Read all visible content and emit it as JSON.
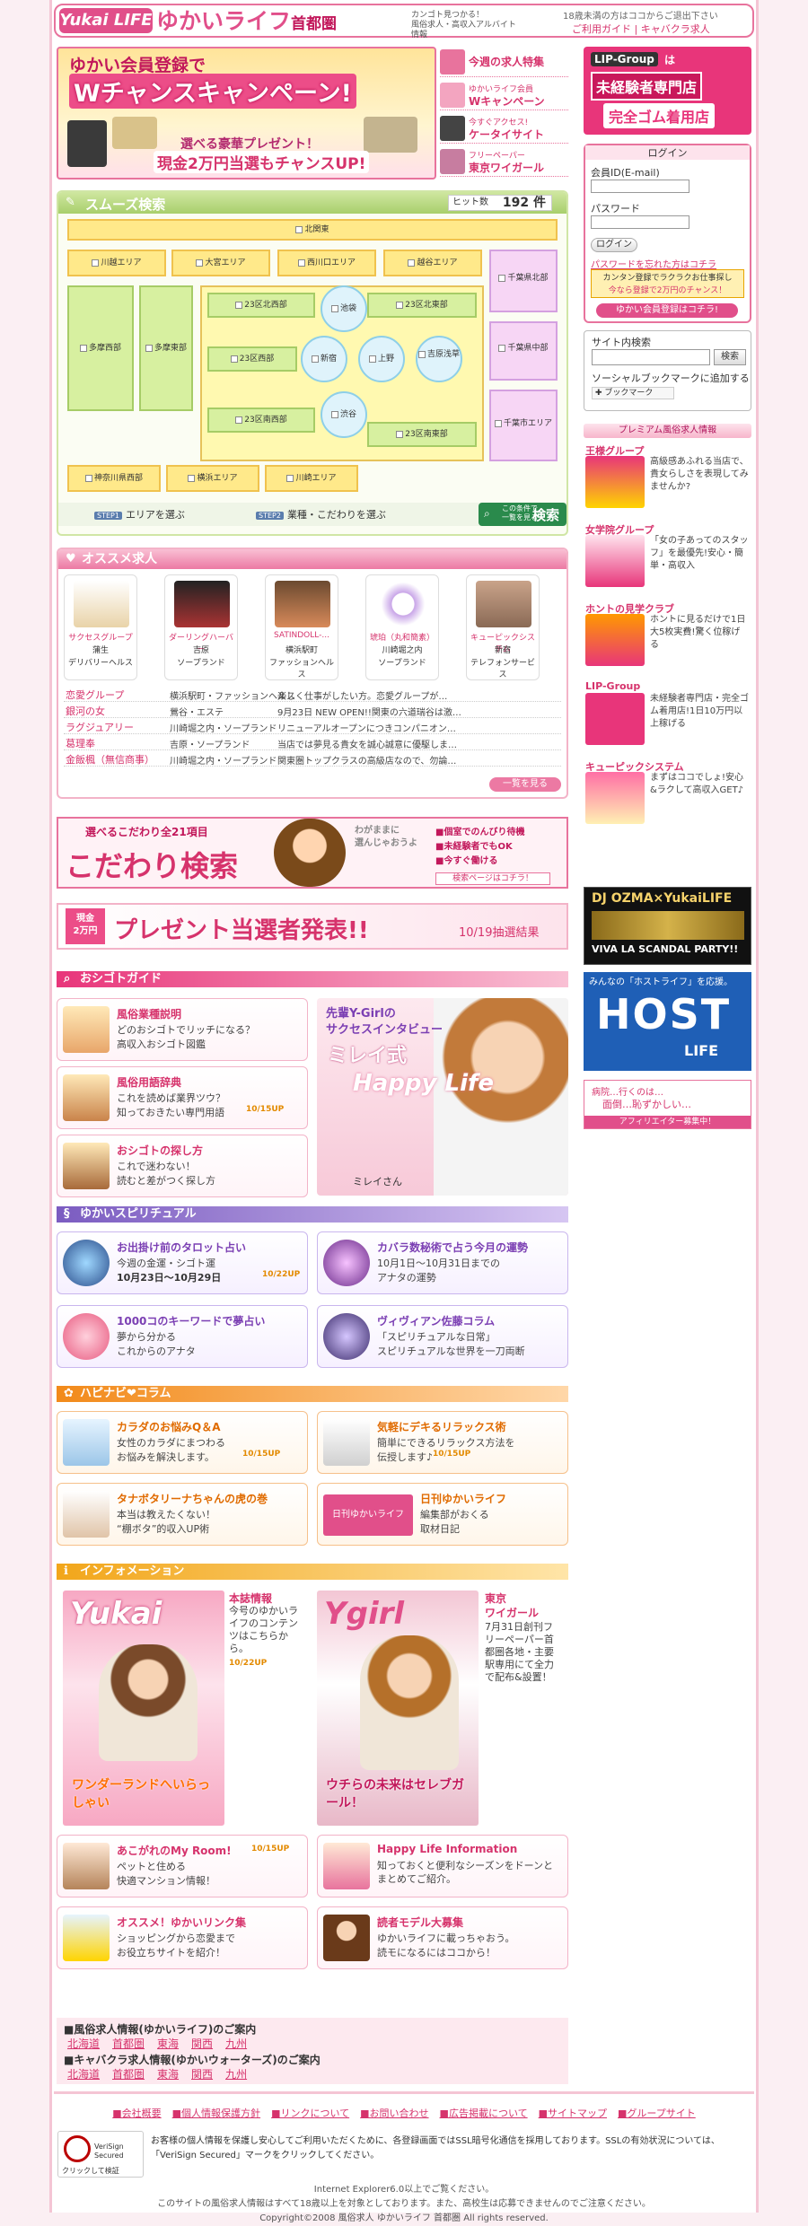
{
  "header": {
    "logo": "Yukai LIFE",
    "brand": "ゆかいライフ",
    "brand_city": "首都圏",
    "tagline1": "カンゴト見つかる！",
    "tagline2": "風俗求人・高収入アルバイト情報",
    "age_note": "18歳未満の方はココからご退出下さい",
    "usage_guide": "ご利用ガイド",
    "cabaret": "キャバクラ求人"
  },
  "campaign": {
    "line1": "ゆかい会員登録で",
    "line2": "Wチャンスキャンペーン!",
    "line3": "選べる豪華プレゼント！",
    "line4": "現金2万円当選もチャンスUP!"
  },
  "topics": [
    {
      "t1": "",
      "t2": "今週の求人特集"
    },
    {
      "t1": "ゆかいライフ会員",
      "t2": "Wキャンペーン"
    },
    {
      "t1": "今すぐアクセス!",
      "t2": "ケータイサイト"
    },
    {
      "t1": "フリーペーパー",
      "t2": "東京ワイガール"
    }
  ],
  "lip": {
    "logo": "LIP-Group",
    "wa": "は",
    "line1": "未経験者専門店",
    "line2": "完全ゴム着用店"
  },
  "login": {
    "title": "ログイン",
    "id_label": "会員ID(E-mail)",
    "pw_label": "パスワード",
    "button": "ログイン",
    "forgot": "パスワードを忘れた方はコチラ",
    "promo1": "カンタン登録でラクラクお仕事探し",
    "promo2": "今なら登録で2万円のチャンス！",
    "register": "ゆかい会員登録はコチラ!"
  },
  "search": {
    "label": "サイト内検索",
    "button": "検索",
    "social": "ソーシャルブックマークに追加する",
    "bookmark": "ブックマーク"
  },
  "premium": {
    "title": "プレミアム風俗求人情報",
    "items": [
      {
        "name": "王様グループ",
        "desc": "高級感あふれる当店で、貴女らしさを表現してみませんか?"
      },
      {
        "name": "女学院グループ",
        "desc": "「女の子あってのスタッフ」を最優先!安心・簡単・高収入"
      },
      {
        "name": "ホントの見学クラブ",
        "desc": "ホントに見るだけで1日大5枚実費!驚く位稼げる"
      },
      {
        "name": "LIP-Group",
        "desc": "未経験者専門店・完全ゴム着用店!1日10万円以上稼げる"
      },
      {
        "name": "キューピックシステム",
        "desc": "まずはココでしょ!安心&ラクして高収入GET♪"
      }
    ]
  },
  "dj": {
    "t1": "DJ OZMA×YukaiLIFE",
    "t2": "VIVA LA SCANDAL PARTY!!"
  },
  "host": {
    "t1": "みんなの「ホストライフ」を応援。",
    "t2": "HOST",
    "t3": "LIFE"
  },
  "affiliate": {
    "t1": "病院…行くのは…",
    "t2": "面倒…恥ずかしい…",
    "t3": "アフィリエイター募集中！"
  },
  "smooth": {
    "title": "スムーズ検索",
    "hit_label": "ヒット数",
    "hit_count": "192",
    "hit_unit": "件",
    "areas": {
      "kitakanto": "北関東",
      "kawagoe": "川越エリア",
      "omiya": "大宮エリア",
      "nishiguchi": "西川口エリア",
      "koshigaya": "越谷エリア",
      "chiba_n": "千葉県北部",
      "tama_w": "多摩西部",
      "tama_e": "多摩東部",
      "ku_nw": "23区北西部",
      "ikebukuro": "池袋",
      "ku_ne": "23区北東部",
      "ku_w": "23区西部",
      "shinjuku": "新宿",
      "ueno": "上野",
      "kinshi": "吉原浅草",
      "chiba_c": "千葉県中部",
      "ku_sw": "23区南西部",
      "shibuya": "渋谷",
      "ku_se": "23区南東部",
      "chiba_s": "千葉市エリア",
      "kanagawa": "神奈川県西部",
      "yokohama": "横浜エリア",
      "kawasaki": "川崎エリア"
    },
    "step1_tag": "STEP1",
    "step1": "エリアを選ぶ",
    "step2_tag": "STEP2",
    "step2": "業種・こだわりを選ぶ",
    "go_small1": "この条件で",
    "go_small2": "一覧を見る",
    "go": "検索"
  },
  "recommend": {
    "title": "オススメ求人",
    "cards": [
      {
        "name": "サクセスグループ",
        "loc": "蒲生",
        "type": "デリバリーヘルス"
      },
      {
        "name": "ダーリングハーバー",
        "loc": "吉原",
        "type": "ソープランド"
      },
      {
        "name": "SATINDOLL-...",
        "loc": "横浜駅町",
        "type": "ファッションヘルス"
      },
      {
        "name": "琥珀（丸和簡素）",
        "loc": "川崎堀之内",
        "type": "ソープランド"
      },
      {
        "name": "キューピックシステム",
        "loc": "新宿",
        "type": "テレフォンサービス"
      }
    ],
    "rows": [
      {
        "c1": "恋愛グループ",
        "c2": "横浜駅町・ファッションヘルス",
        "c3": "楽しく仕事がしたい方。恋愛グループが…"
      },
      {
        "c1": "銀河の女",
        "c2": "鶯谷・エステ",
        "c3": "9月23日 NEW OPEN!!関東の六道瑞谷は激…"
      },
      {
        "c1": "ラグジュアリー",
        "c2": "川崎堀之内・ソープランド",
        "c3": "リニューアルオープンにつきコンパニオン…"
      },
      {
        "c1": "葛理奉",
        "c2": "吉原・ソープランド",
        "c3": "当店では夢見る貴女を誠心誠意に優駆しま…"
      },
      {
        "c1": "金飯楓（無信商事）",
        "c2": "川崎堀之内・ソープランド",
        "c3": "関東圏トップクラスの高級店なので、勿論…"
      }
    ],
    "more": "一覧を見る"
  },
  "kodawari": {
    "l1": "選べるこだわり全21項目",
    "l2": "こだわり検索",
    "b1": "個室でのんびり待機",
    "b2": "未経験者でもOK",
    "b3": "今すぐ働ける",
    "s1": "わがままに",
    "s2": "選んじゃおうよ",
    "btn": "検索ページはコチラ！"
  },
  "present": {
    "badge1": "現金",
    "badge2": "2万円",
    "title": "プレゼント当選者発表!!",
    "date": "10/19抽選結果"
  },
  "guide": {
    "title": "おシゴトガイド",
    "cards": [
      {
        "ttl": "風俗業種説明",
        "d1": "どのおシゴトでリッチになる？",
        "d2": "高収入おシゴト図鑑",
        "dt": ""
      },
      {
        "ttl": "風俗用語辞典",
        "d1": "これを読めば業界ツウ？",
        "d2": "知っておきたい専門用語",
        "dt": "10/15UP"
      },
      {
        "ttl": "おシゴトの探し方",
        "d1": "これで迷わない！",
        "d2": "読むと差がつく探し方",
        "dt": ""
      }
    ],
    "iv_t1": "先輩Y-Girlの",
    "iv_t2": "サクセスインタビュー",
    "iv_t3": "ミレイ式",
    "iv_t4": "Happy Life",
    "iv_name": "ミレイさん"
  },
  "spiritual": {
    "title": "ゆかいスピリチュアル",
    "cards": [
      {
        "ttl": "お出掛け前のタロット占い",
        "d1": "今週の金運・シゴト運",
        "d2": "10月23日〜10月29日",
        "dt": "10/22UP"
      },
      {
        "ttl": "カバラ数秘術で占う今月の運勢",
        "d1": "10月1日〜10月31日までの",
        "d2": "アナタの運勢",
        "dt": ""
      },
      {
        "ttl": "1000コのキーワードで夢占い",
        "d1": "夢から分かる",
        "d2": "これからのアナタ",
        "dt": ""
      },
      {
        "ttl": "ヴィヴィアン佐藤コラム",
        "d1": "「スピリチュアルな日常」",
        "d2": "スピリチュアルな世界を一刀両断",
        "dt": ""
      }
    ]
  },
  "column": {
    "title": "ハピナビ❤コラム",
    "cards": [
      {
        "ttl": "カラダのお悩みQ＆A",
        "d1": "女性のカラダにまつわる",
        "d2": "お悩みを解決します。",
        "dt": "10/15UP"
      },
      {
        "ttl": "気軽にデキるリラックス術",
        "d1": "簡単にできるリラックス方法を",
        "d2": "伝授します♪",
        "dt": "10/15UP"
      },
      {
        "ttl": "タナボタリーナちゃんの虎の巻",
        "d1": "本当は教えたくない！",
        "d2": "“棚ボタ”的収入UP術",
        "dt": ""
      },
      {
        "ttl": "日刊ゆかいライフ",
        "d1": "編集部がおくる",
        "d2": "取材日記",
        "dt": ""
      }
    ],
    "banner": "日刊ゆかいライフ"
  },
  "info": {
    "title": "インフォメーション",
    "mag1_t": "本誌情報",
    "mag1_d": "今号のゆかいライフのコンテンツはこちらから。",
    "mag1_dt": "10/22UP",
    "mag2_t1": "東京",
    "mag2_t2": "ワイガール",
    "mag2_d": "7月31日創刊フリーペーパー首都圏各地・主要駅専用にて全力で配布&設置！",
    "mag1_cover": "Yukai",
    "mag2_cover": "Ygirl",
    "mag1_sub": "ワンダーランドへいらっしゃい",
    "mag2_sub": "ウチらの未来はセレブガール！",
    "cards": [
      {
        "ttl": "あこがれのMy Room!",
        "d1": "ペットと住める",
        "d2": "快適マンション情報！",
        "dt": "10/15UP"
      },
      {
        "ttl": "Happy Life Information",
        "d1": "知っておくと便利なシーズンをドーンとまとめてご紹介。",
        "d2": "",
        "dt": ""
      },
      {
        "ttl": "オススメ！ゆかいリンク集",
        "d1": "ショッピングから恋愛まで",
        "d2": "お役立ちサイトを紹介！",
        "dt": ""
      },
      {
        "ttl": "読者モデル大募集",
        "d1": "ゆかいライフに載っちゃおう。",
        "d2": "読モになるにはココから！",
        "dt": ""
      }
    ]
  },
  "area_links": {
    "t1": "■風俗求人情報(ゆかいライフ)のご案内",
    "row1": [
      "北海道",
      "首都圏",
      "東海",
      "関西",
      "九州"
    ],
    "t2": "■キャバクラ求人情報(ゆかいウォーターズ)のご案内",
    "row2": [
      "北海道",
      "首都圏",
      "東海",
      "関西",
      "九州"
    ]
  },
  "footer": {
    "nav": [
      "■会社概要",
      "■個人情報保護方針",
      "■リンクについて",
      "■お問い合わせ",
      "■広告掲載について",
      "■サイトマップ",
      "■グループサイト"
    ],
    "vs_label1": "VeriSign",
    "vs_label2": "Secured",
    "vs_click": "クリックして検証",
    "privacy": "お客様の個人情報を保護し安心してご利用いただくために、各登録画面ではSSL暗号化通信を採用しております。SSLの有効状況については、「VeriSign Secured」マークをクリックしてください。",
    "ie": "Internet Explorer6.0以上でご覧ください。",
    "age": "このサイトの風俗求人情報はすべて18歳以上を対象としております。また、高校生は応募できませんのでご注意ください。",
    "copy": "Copyright©2008 風俗求人 ゆかいライフ 首都圏 All rights reserved."
  }
}
